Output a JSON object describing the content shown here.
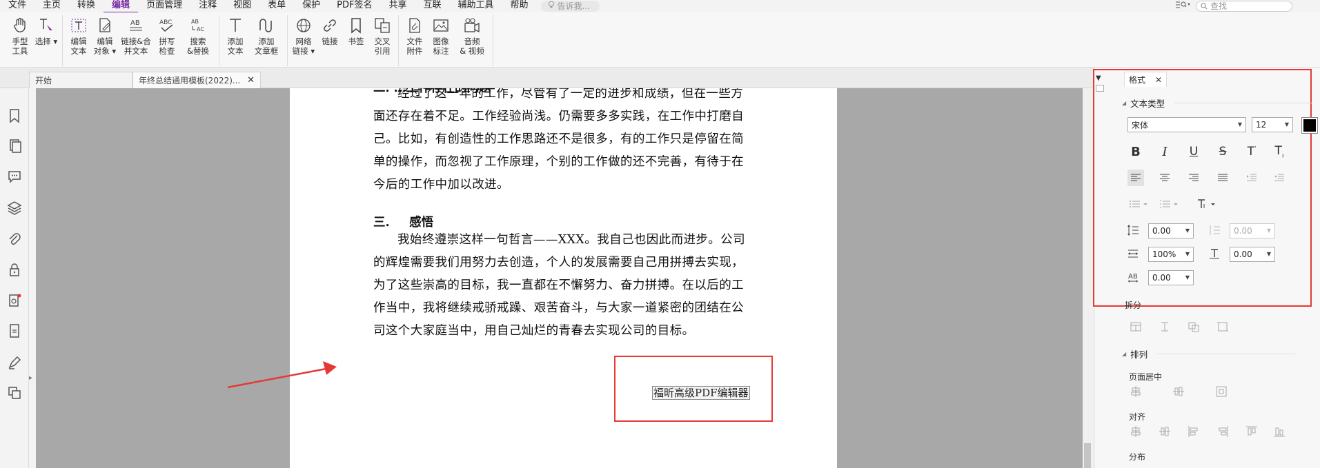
{
  "menu": {
    "items": [
      "文件",
      "主页",
      "转换",
      "编辑",
      "页面管理",
      "注释",
      "视图",
      "表单",
      "保护",
      "PDF签名",
      "共享",
      "互联",
      "辅助工具",
      "帮助"
    ],
    "active": "编辑",
    "search_hint": "告诉我...",
    "find_placeholder": "查找"
  },
  "ribbon": {
    "groups": [
      [
        {
          "label": "手型\n工具",
          "icon": "hand-icon"
        },
        {
          "label": "选择",
          "icon": "select-icon"
        }
      ],
      [
        {
          "label": "编辑\n文本",
          "icon": "edit-text-icon"
        },
        {
          "label": "编辑\n对象",
          "icon": "edit-object-icon"
        },
        {
          "label": "链接&合\n并文本",
          "icon": "link-merge-text-icon"
        },
        {
          "label": "拼写\n检查",
          "icon": "spell-check-icon"
        },
        {
          "label": "搜索\n&替换",
          "icon": "search-replace-icon"
        }
      ],
      [
        {
          "label": "添加\n文本",
          "icon": "add-text-icon"
        },
        {
          "label": "添加\n文章框",
          "icon": "add-article-box-icon"
        }
      ],
      [
        {
          "label": "网络\n链接",
          "icon": "web-link-icon"
        },
        {
          "label": "链接",
          "icon": "link-icon"
        },
        {
          "label": "书签",
          "icon": "bookmark-icon"
        },
        {
          "label": "交叉\n引用",
          "icon": "cross-reference-icon"
        }
      ],
      [
        {
          "label": "文件\n附件",
          "icon": "file-attachment-icon"
        },
        {
          "label": "图像\n标注",
          "icon": "image-annotation-icon"
        },
        {
          "label": "音频\n& 视频",
          "icon": "audio-video-icon"
        }
      ]
    ]
  },
  "tabs": {
    "start": "开始",
    "document": "年终总结通用模板(2022)..."
  },
  "document": {
    "partial_heading": "二.   ...工作存在的问题",
    "paragraph1": [
      "经过了这一年的工作，尽管有了一定的进步和成绩，但在一些方",
      "面还存在着不足。工作经验尚浅。仍需要多多实践，在工作中打磨自",
      "己。比如，有创造性的工作思路还不是很多，有的工作只是停留在简",
      "单的操作，而忽视了工作原理，个别的工作做的还不完善，有待于在",
      "今后的工作中加以改进。"
    ],
    "section_number": "三.",
    "section_title": "感悟",
    "paragraph2": [
      "我始终遵崇这样一句哲言——XXX。我自己也因此而进步。公司",
      "的辉煌需要我们用努力去创造，个人的发展需要自己用拼搏去实现，",
      "为了这些崇高的目标，我一直都在不懈努力、奋力拼搏。在以后的工",
      "作当中，我将继续戒骄戒躁、艰苦奋斗，与大家一道紧密的团结在公",
      "司这个大家庭当中，用自己灿烂的青春去实现公司的目标。"
    ],
    "textbox": "福昕高级PDF编辑器"
  },
  "format_panel": {
    "tab_label": "格式",
    "text_type_title": "文本类型",
    "font": "宋体",
    "font_size": "12",
    "font_color": "#000000",
    "line_spacing": "0.00",
    "para_spacing": "0.00",
    "scale": "100%",
    "baseline": "0.00",
    "char_spacing": "0.00",
    "split_title": "拆分",
    "arrange_title": "排列",
    "page_center_label": "页面居中",
    "align_label": "对齐",
    "distribute_label": "分布"
  },
  "colors": {
    "accent": "#7b2fa3",
    "highlight": "#e53935"
  }
}
